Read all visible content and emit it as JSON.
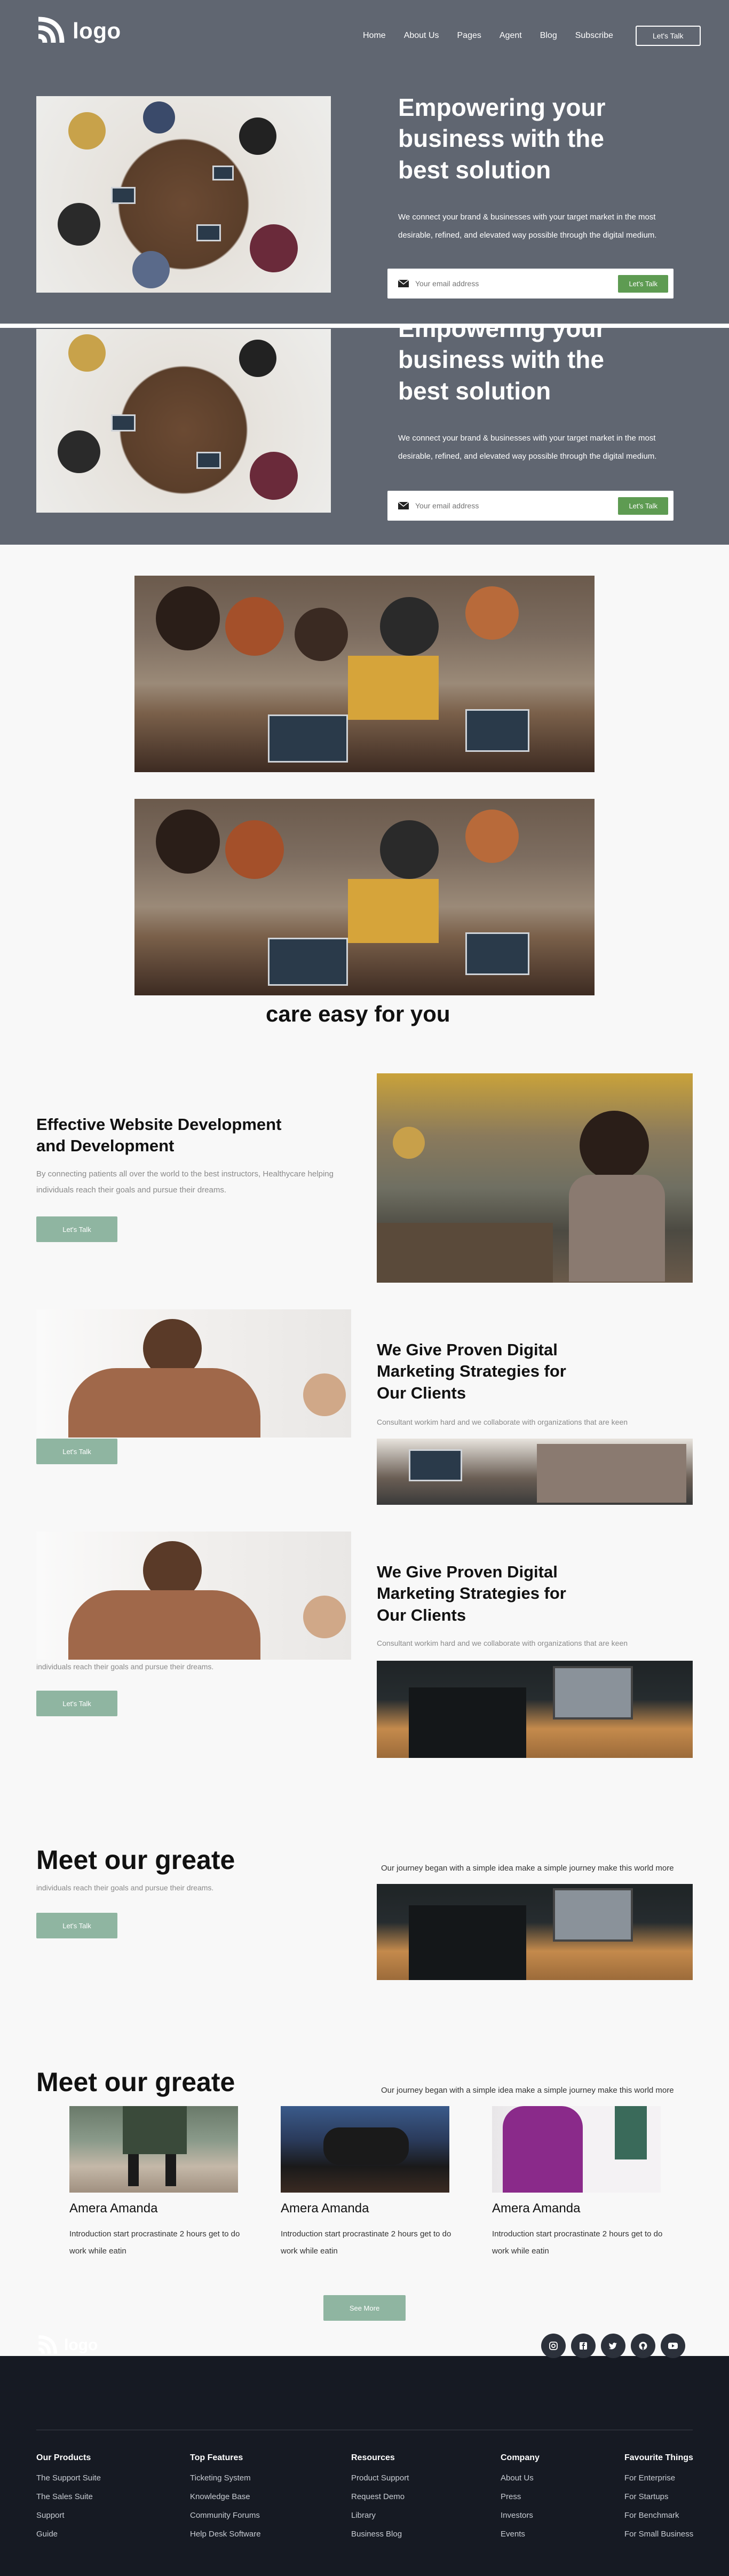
{
  "brand": {
    "logo_text": "logo",
    "accent": "#5e9b52",
    "button_color": "#8fb5a1",
    "header_bg": "#606671",
    "footer_bg": "#161a23"
  },
  "nav": {
    "items": [
      "Home",
      "About Us",
      "Pages",
      "Agent",
      "Blog",
      "Subscribe"
    ],
    "cta": "Let's Talk"
  },
  "hero": {
    "title": "Empowering your business with the best solution",
    "description": "We connect your brand & businesses with your target market in the most desirable, refined, and elevated way possible through the digital medium.",
    "email_placeholder": "Your email address",
    "submit": "Let's Talk"
  },
  "care": {
    "title": "care easy for you"
  },
  "features": [
    {
      "title": "Effective Website Development and Development",
      "text": "By connecting patients all over the world to the best instructors, Healthycare helping individuals reach their goals and pursue their dreams.",
      "button": "Let's Talk"
    },
    {
      "title": "We Give Proven Digital Marketing Strategies for Our Clients",
      "text": "Consultant workim hard and we collaborate with organizations that are keen",
      "button": "Let's Talk"
    },
    {
      "title": "We Give Proven Digital Marketing Strategies for Our Clients",
      "text": "Consultant workim hard and we collaborate with organizations that are keen",
      "extra": "individuals reach their goals and pursue their dreams.",
      "button": "Let's Talk"
    }
  ],
  "meet": {
    "title": "Meet our greate",
    "subtitle": "individuals reach their goals and pursue their dreams.",
    "button": "Let's Talk",
    "journey": "Our journey began with a simple idea make a simple journey make this world more"
  },
  "team": {
    "title": "Meet our greate",
    "journey": "Our journey began with a simple idea make a simple journey make this world more",
    "cards": [
      {
        "name": "Amera Amanda",
        "desc": "Introduction start procrastinate 2 hours get to do work while eatin"
      },
      {
        "name": "Amera Amanda",
        "desc": "Introduction start procrastinate 2 hours get to do work while eatin"
      },
      {
        "name": "Amera Amanda",
        "desc": "Introduction start procrastinate 2 hours get to do work while eatin"
      }
    ],
    "see_more": "See More"
  },
  "footer": {
    "logo_text": "logo",
    "social_icons": [
      "instagram-icon",
      "facebook-icon",
      "twitter-icon",
      "github-icon",
      "youtube-icon"
    ],
    "columns": [
      {
        "title": "Our Products",
        "links": [
          "The Support Suite",
          "The Sales Suite",
          "Support",
          "Guide"
        ]
      },
      {
        "title": "Top Features",
        "links": [
          "Ticketing System",
          "Knowledge Base",
          "Community Forums",
          "Help Desk Software"
        ]
      },
      {
        "title": "Resources",
        "links": [
          "Product Support",
          "Request Demo",
          "Library",
          "Business Blog"
        ]
      },
      {
        "title": "Company",
        "links": [
          "About Us",
          "Press",
          "Investors",
          "Events"
        ]
      },
      {
        "title": "Favourite Things",
        "links": [
          "For Enterprise",
          "For Startups",
          "For Benchmark",
          "For Small Business"
        ]
      }
    ]
  }
}
